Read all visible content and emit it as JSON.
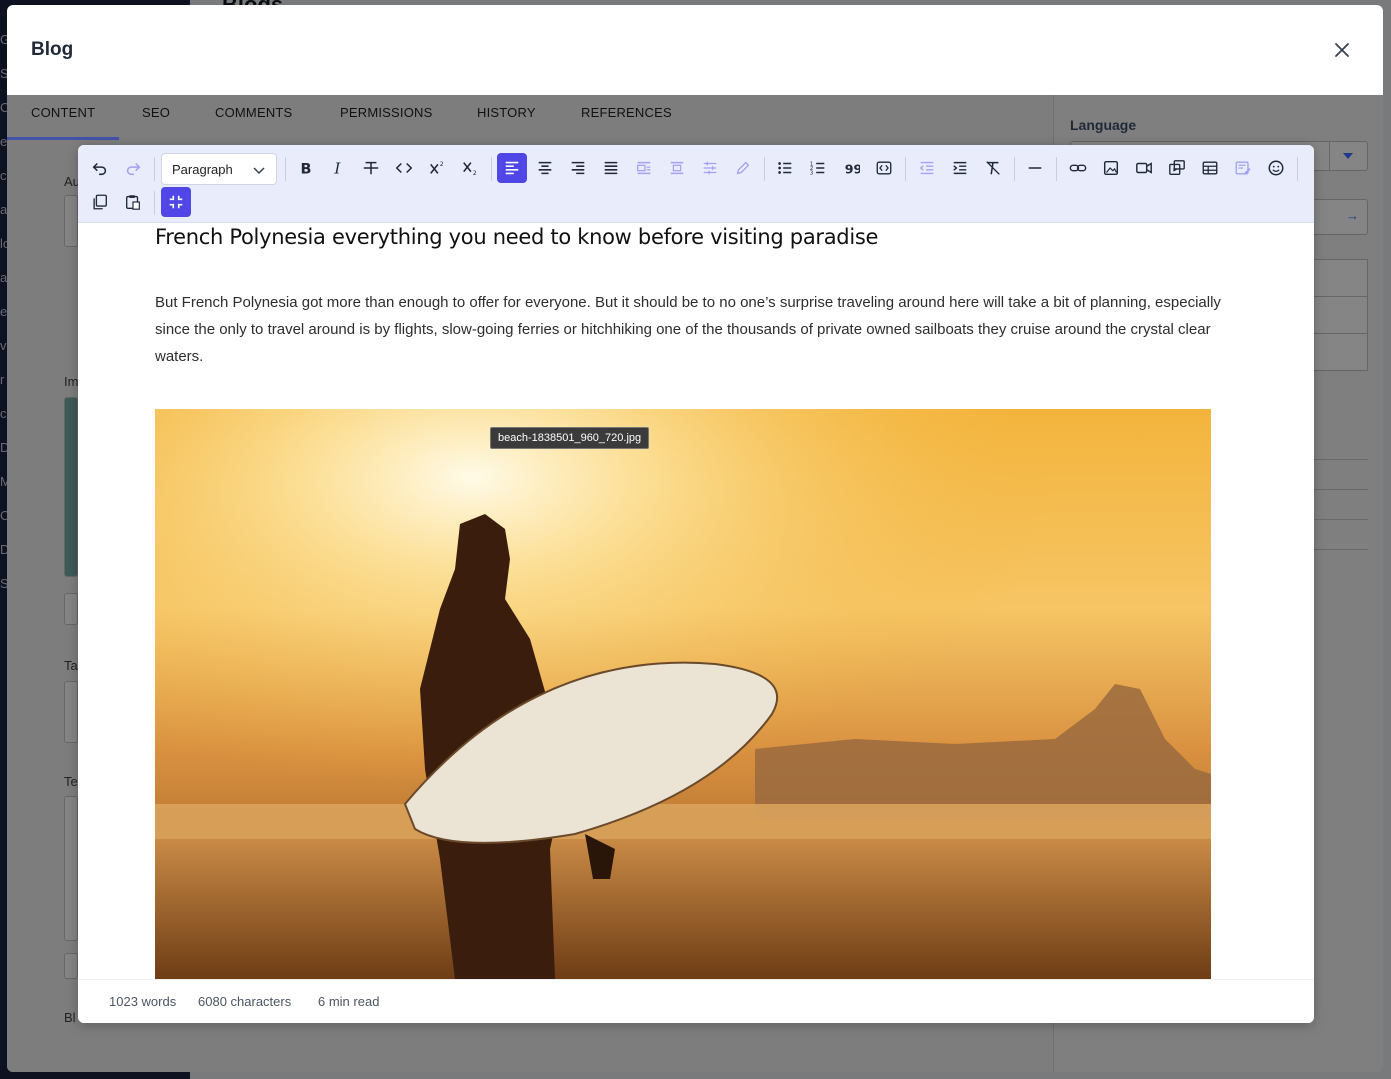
{
  "background": {
    "page_title": "Blogs",
    "sidebar_letters": [
      "G",
      "S",
      "C",
      "e",
      "c",
      "a",
      "lo",
      "a",
      "e",
      "v",
      "r",
      "c",
      "D",
      "M",
      "C",
      "D",
      "S"
    ]
  },
  "modal": {
    "title": "Blog",
    "close_icon": "close-icon",
    "tabs": [
      "CONTENT",
      "SEO",
      "COMMENTS",
      "PERMISSIONS",
      "HISTORY",
      "REFERENCES"
    ],
    "active_tab": "CONTENT",
    "right_panel": {
      "language_label": "Language"
    },
    "left_labels": [
      "Au",
      "Im",
      "Ta",
      "Te",
      "Bl"
    ]
  },
  "editor": {
    "block_format": "Paragraph",
    "toolbar_icons": [
      "undo-icon",
      "redo-icon",
      "bold-icon",
      "italic-icon",
      "strikethrough-icon",
      "code-icon",
      "superscript-icon",
      "subscript-icon",
      "align-left-icon",
      "align-center-icon",
      "align-right-icon",
      "align-justify-icon",
      "image-align-left-icon",
      "image-align-center-icon",
      "line-height-icon",
      "highlight-icon",
      "bullet-list-icon",
      "numbered-list-icon",
      "blockquote-icon",
      "code-block-icon",
      "outdent-icon",
      "indent-icon",
      "clear-format-icon",
      "horizontal-rule-icon",
      "link-icon",
      "image-icon",
      "video-icon",
      "media-embed-icon",
      "table-icon",
      "template-icon",
      "emoji-icon",
      "copy-icon",
      "paste-icon",
      "exit-fullscreen-icon"
    ],
    "heading": "French Polynesia everything you need to know before visiting paradise",
    "paragraph": "But French Polynesia got more than enough to offer for everyone. But it should be to no one’s surprise traveling around here will take a bit of planning, especially since the only to travel around is by flights, slow-going ferries or hitchhiking one of the thousands of private owned sailboats they cruise around the crystal clear waters.",
    "image_filename": "beach-1838501_960_720.jpg",
    "status": {
      "words": "1023 words",
      "characters": "6080 characters",
      "read_time": "6 min read"
    }
  },
  "colors": {
    "accent": "#4f46e5",
    "toolbar_bg": "#e9edfb",
    "sidebar_bg": "#1b2241",
    "tab_underline": "#4453a8"
  }
}
